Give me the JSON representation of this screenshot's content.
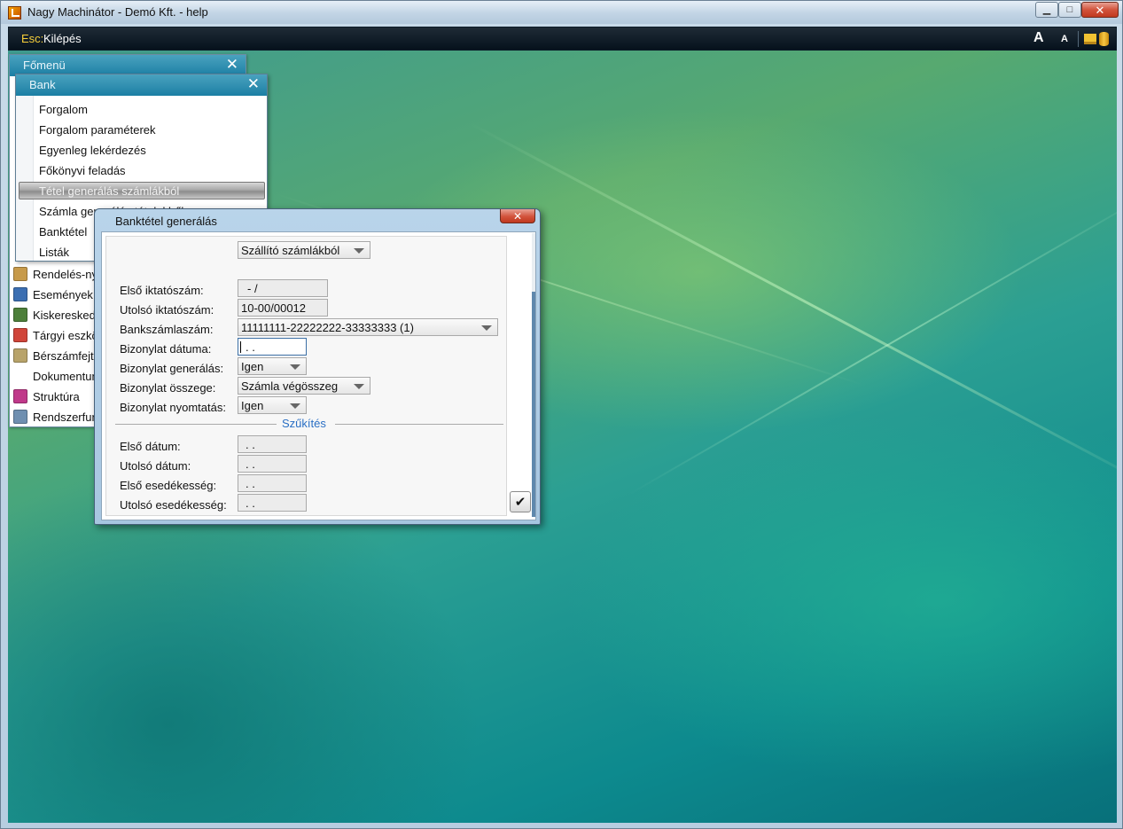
{
  "window": {
    "title": "Nagy Machinátor - Demó Kft. - help",
    "minimize_glyph": "▁",
    "maximize_glyph": "□",
    "close_glyph": "✕"
  },
  "toolbar": {
    "esc_key": "Esc:",
    "esc_label": "Kilépés",
    "font_large": "A",
    "font_small": "A"
  },
  "main_menu": {
    "title": "Főmenü",
    "close_glyph": "✕",
    "items": [
      {
        "label": "Rendelés-nyilvántartás",
        "icon": "package-icon",
        "color": "#c79a4a"
      },
      {
        "label": "Események",
        "icon": "person-icon",
        "color": "#3c6fb2"
      },
      {
        "label": "Kiskereskedelem",
        "icon": "cash-register-icon",
        "color": "#4d7f3a"
      },
      {
        "label": "Tárgyi eszközök",
        "icon": "asset-cube-icon",
        "color": "#d0453a"
      },
      {
        "label": "Bérszámfejtés",
        "icon": "payroll-icon",
        "color": "#b8a36a"
      },
      {
        "label": "Dokumentumok",
        "icon": "document-icon",
        "color": "#ffffff"
      },
      {
        "label": "Struktúra",
        "icon": "structure-icon",
        "color": "#c0398a"
      },
      {
        "label": "Rendszerfunkciók",
        "icon": "gears-icon",
        "color": "#6f8fb0"
      }
    ]
  },
  "bank_menu": {
    "title": "Bank",
    "close_glyph": "✕",
    "items": [
      "Forgalom",
      "Forgalom paraméterek",
      "Egyenleg lekérdezés",
      "Főkönyvi feladás",
      "Tétel generálás számlákból",
      "Számla generálás tételekből",
      "Banktétel",
      "Listák"
    ],
    "selected_index": 4
  },
  "dialog": {
    "title": "Banktétel generálás",
    "close_glyph": "✕",
    "source_select": "Szállító számlákból",
    "fields": {
      "elso_iktatoszam": {
        "label": "Első iktatószám:",
        "value": " -  /"
      },
      "utolso_iktatoszam": {
        "label": "Utolsó iktatószám:",
        "value": "10-00/00012"
      },
      "bankszamlaszam": {
        "label": "Bankszámlaszám:",
        "value": "11111111-22222222-33333333 (1)"
      },
      "bizonylat_datuma": {
        "label": "Bizonylat dátuma:",
        "value": " . ."
      },
      "bizonylat_generalas": {
        "label": "Bizonylat generálás:",
        "value": "Igen"
      },
      "bizonylat_osszege": {
        "label": "Bizonylat összege:",
        "value": "Számla végösszeg"
      },
      "bizonylat_nyomtatas": {
        "label": "Bizonylat nyomtatás:",
        "value": "Igen"
      }
    },
    "section_title": "Szűkítés",
    "filter_fields": {
      "elso_datum": {
        "label": "Első dátum:",
        "value": " . ."
      },
      "utolso_datum": {
        "label": "Utolsó dátum:",
        "value": " . ."
      },
      "elso_esedekesseg": {
        "label": "Első esedékesség:",
        "value": " . ."
      },
      "utolso_esedekesseg": {
        "label": "Utolsó esedékesség:",
        "value": " . ."
      }
    },
    "ok_glyph": "✔"
  }
}
